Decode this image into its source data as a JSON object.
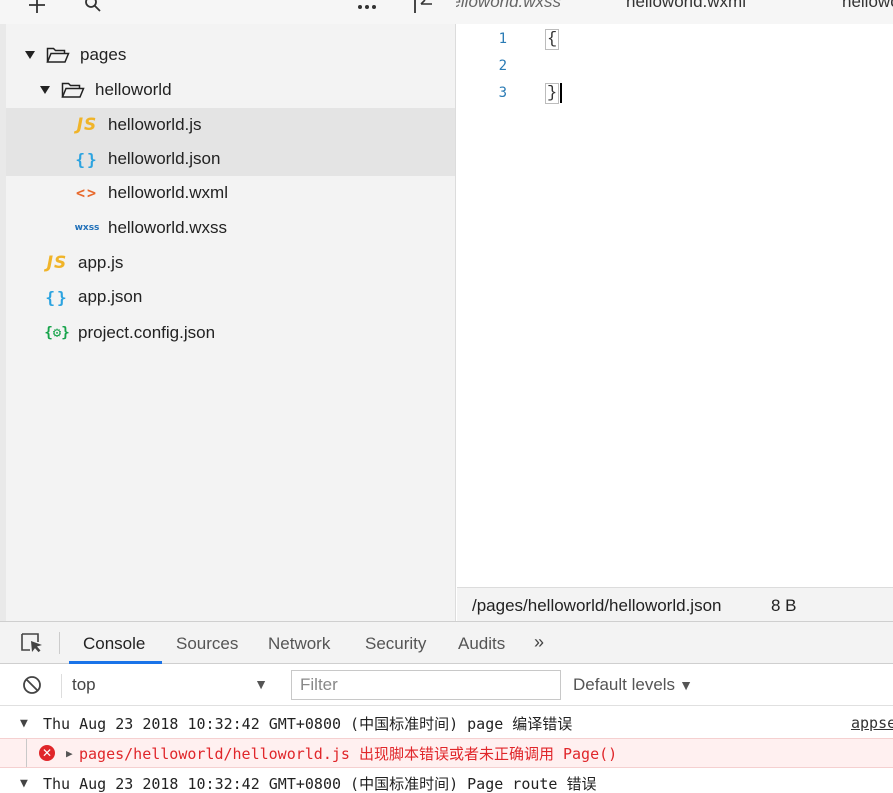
{
  "toolbar": {
    "add_icon": "plus-icon",
    "search_icon": "search-icon",
    "more_icon": "more-icon",
    "collapse_icon": "collapse-icon"
  },
  "tabs": [
    {
      "label": "helloworld.wxss"
    },
    {
      "label": "helloworld.wxml"
    },
    {
      "label": "helloworld.json"
    }
  ],
  "tree": {
    "items": [
      {
        "label": "pages",
        "kind": "folder",
        "expanded": true
      },
      {
        "label": "helloworld",
        "kind": "folder",
        "expanded": true
      },
      {
        "label": "helloworld.js",
        "kind": "js",
        "icon_text": "JS"
      },
      {
        "label": "helloworld.json",
        "kind": "json",
        "icon_text": "{}"
      },
      {
        "label": "helloworld.wxml",
        "kind": "wxml",
        "icon_text": "<>"
      },
      {
        "label": "helloworld.wxss",
        "kind": "wxss",
        "icon_text": "wxss"
      },
      {
        "label": "app.js",
        "kind": "js",
        "icon_text": "JS"
      },
      {
        "label": "app.json",
        "kind": "json",
        "icon_text": "{}"
      },
      {
        "label": "project.config.json",
        "kind": "config",
        "icon_text": "{⚙}"
      }
    ]
  },
  "editor": {
    "lines": [
      {
        "number": "1",
        "text": "{"
      },
      {
        "number": "2",
        "text": ""
      },
      {
        "number": "3",
        "text": "}"
      }
    ]
  },
  "status": {
    "path": "/pages/helloworld/helloworld.json",
    "size": "8 B"
  },
  "devtools": {
    "tabs": [
      "Console",
      "Sources",
      "Network",
      "Security",
      "Audits"
    ],
    "more": "»",
    "context": "top",
    "filter_placeholder": "Filter",
    "levels": "Default levels",
    "logs": [
      {
        "text": "Thu Aug 23 2018 10:32:42 GMT+0800 (中国标准时间) page 编译错误",
        "source": "appse"
      },
      {
        "text": "pages/helloworld/helloworld.js 出现脚本错误或者未正确调用 Page()"
      },
      {
        "text": "Thu Aug 23 2018 10:32:42 GMT+0800 (中国标准时间) Page route 错误"
      }
    ]
  },
  "colors": {
    "accent": "#1a73e8",
    "error": "#e0262a",
    "js_icon": "#f0b429",
    "json_icon": "#2ba3e0",
    "wxml_icon": "#e8692c",
    "wxss_icon": "#1f6fb8",
    "config_icon": "#16a34a"
  }
}
